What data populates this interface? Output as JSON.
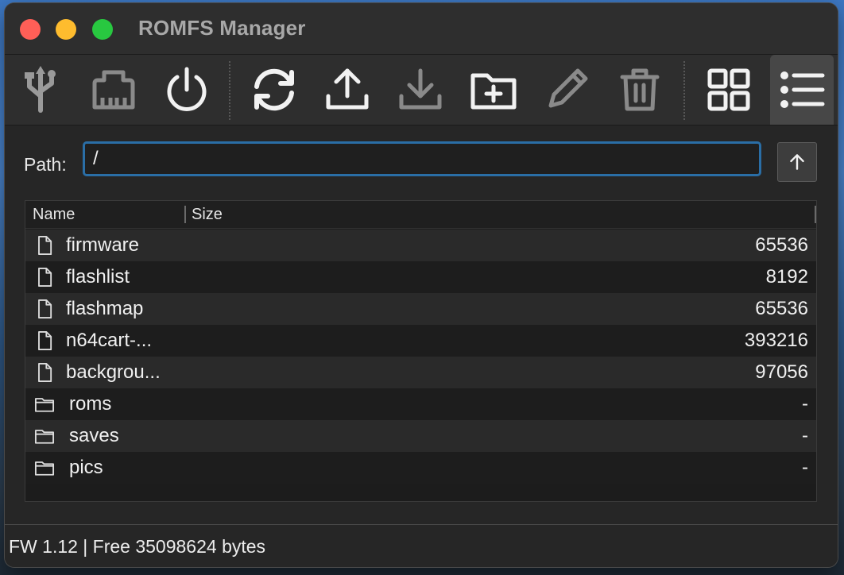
{
  "window": {
    "title": "ROMFS Manager"
  },
  "toolbar": {
    "buttons": [
      {
        "icon": "usb-icon",
        "enabled": true
      },
      {
        "icon": "cartridge-icon",
        "enabled": false
      },
      {
        "icon": "power-icon",
        "enabled": true
      },
      {
        "icon": "refresh-icon",
        "enabled": true
      },
      {
        "icon": "upload-icon",
        "enabled": true
      },
      {
        "icon": "download-icon",
        "enabled": false
      },
      {
        "icon": "new-folder-icon",
        "enabled": true
      },
      {
        "icon": "rename-pencil-icon",
        "enabled": false
      },
      {
        "icon": "trash-icon",
        "enabled": false
      },
      {
        "icon": "grid-view-icon",
        "enabled": true
      },
      {
        "icon": "list-view-icon",
        "enabled": true,
        "active": true
      }
    ]
  },
  "path": {
    "label": "Path:",
    "value": "/"
  },
  "list": {
    "columns": {
      "name": "Name",
      "size": "Size"
    },
    "rows": [
      {
        "type": "file",
        "name": "firmware",
        "size": "65536"
      },
      {
        "type": "file",
        "name": "flashlist",
        "size": "8192"
      },
      {
        "type": "file",
        "name": "flashmap",
        "size": "65536"
      },
      {
        "type": "file",
        "name": "n64cart-...",
        "size": "393216"
      },
      {
        "type": "file",
        "name": "backgrou...",
        "size": "97056"
      },
      {
        "type": "folder",
        "name": "roms",
        "size": "-"
      },
      {
        "type": "folder",
        "name": "saves",
        "size": "-"
      },
      {
        "type": "folder",
        "name": "pics",
        "size": "-"
      }
    ]
  },
  "status": {
    "text": "FW 1.12 | Free 35098624 bytes"
  },
  "colors": {
    "enabled_icon": "#f2f2f2",
    "disabled_icon": "#8a8a8a",
    "focus_ring": "#2a6ea6",
    "close": "#ff5f57",
    "minimize": "#febc2e",
    "zoom": "#28c840"
  }
}
